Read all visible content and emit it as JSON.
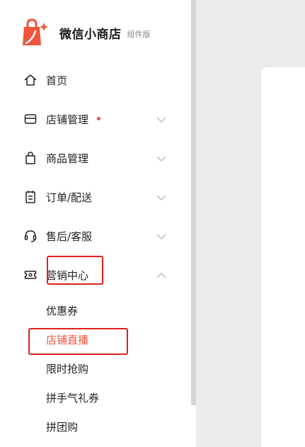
{
  "brand": {
    "name": "微信小商店",
    "tag": "组件版",
    "logo_icon": "shopping-bag-sparkle-icon",
    "accent": "#f0553b"
  },
  "nav": [
    {
      "id": "home",
      "label": "首页",
      "icon": "home-icon",
      "expandable": false
    },
    {
      "id": "shop",
      "label": "店铺管理",
      "icon": "store-icon",
      "expandable": true,
      "badge": true
    },
    {
      "id": "goods",
      "label": "商品管理",
      "icon": "bag-icon",
      "expandable": true
    },
    {
      "id": "orders",
      "label": "订单/配送",
      "icon": "order-icon",
      "expandable": true
    },
    {
      "id": "aftersale",
      "label": "售后/客服",
      "icon": "headset-icon",
      "expandable": true
    },
    {
      "id": "marketing",
      "label": "营销中心",
      "icon": "ticket-icon",
      "expandable": true,
      "expanded": true
    }
  ],
  "marketing_submenu": [
    {
      "label": "优惠券",
      "active": false
    },
    {
      "label": "店铺直播",
      "active": true
    },
    {
      "label": "限时抢购",
      "active": false
    },
    {
      "label": "拼手气礼券",
      "active": false
    },
    {
      "label": "拼团购",
      "active": false
    }
  ],
  "colors": {
    "active": "#f0553b",
    "annotation": "#e0201e",
    "text": "#222222",
    "muted": "#888888",
    "chevron": "#bbbbbb"
  }
}
